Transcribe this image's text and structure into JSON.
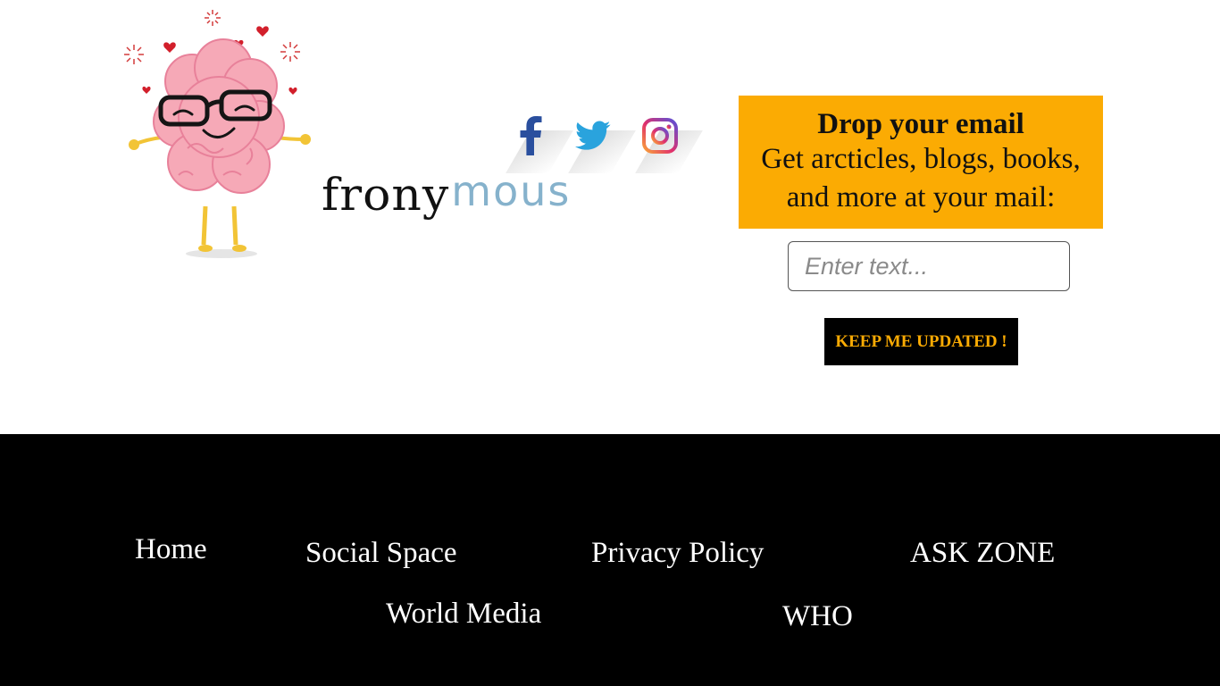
{
  "brand": {
    "logo_part1": "frony",
    "logo_part2": "mous"
  },
  "social": {
    "facebook_icon": "facebook-icon",
    "twitter_icon": "twitter-icon",
    "instagram_icon": "instagram-icon"
  },
  "newsletter": {
    "title": "Drop your email",
    "subtitle": "Get arcticles, blogs, books, and more at your mail:",
    "input_placeholder": "Enter text...",
    "button_label": "KEEP ME UPDATED !",
    "box_color": "#fbab03"
  },
  "footer": {
    "links": {
      "home": "Home",
      "social_space": "Social Space",
      "privacy_policy": "Privacy Policy",
      "ask_zone": "ASK ZONE",
      "world_media": "World Media",
      "who": "WHO"
    }
  }
}
